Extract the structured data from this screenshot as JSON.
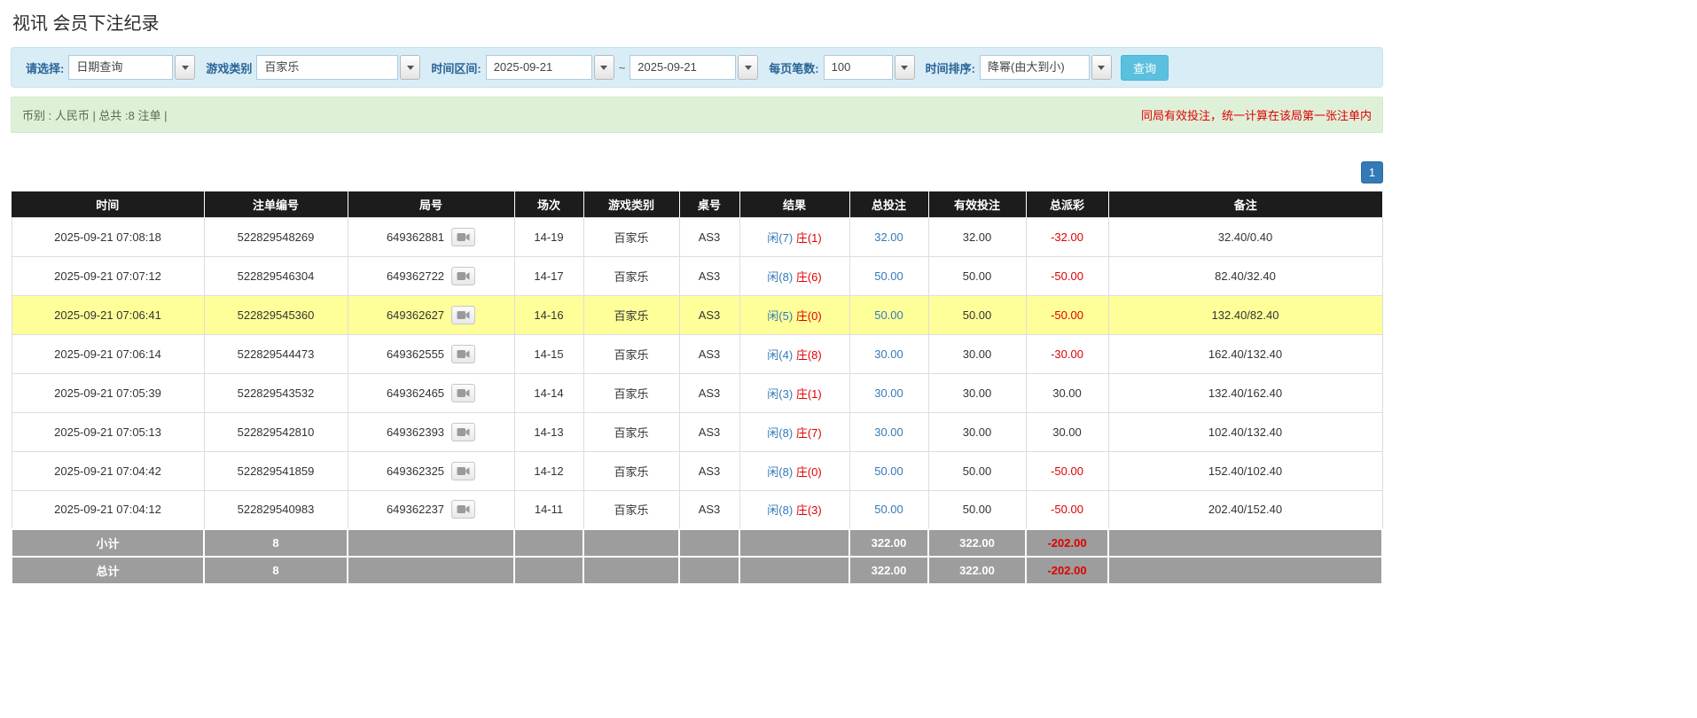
{
  "colors": {
    "accent_blue": "#337ab7",
    "button_blue": "#5bc0de",
    "label_blue": "#2a6496",
    "filter_bg": "#d9edf7",
    "info_bg": "#dff0d8",
    "header_bg": "#1c1c1c",
    "highlight_yellow": "#ffff99",
    "red": "#e00000",
    "footer_gray": "#9d9d9d"
  },
  "page": {
    "title": "视讯 会员下注纪录"
  },
  "filters": {
    "select_label": "请选择:",
    "select_value": "日期查询",
    "game_type_label": "游戏类别",
    "game_type_value": "百家乐",
    "time_range_label": "时间区间:",
    "date_from": "2025-09-21",
    "range_separator": "~",
    "date_to": "2025-09-21",
    "per_page_label": "每页笔数:",
    "per_page_value": "100",
    "sort_label": "时间排序:",
    "sort_value": "降幂(由大到小)",
    "search_button": "查询"
  },
  "info_bar": {
    "summary": "币别 : 人民币 | 总共 :8 注单 |",
    "notice": "同局有效投注，统一计算在该局第一张注单内"
  },
  "pagination": {
    "current_page": "1"
  },
  "table": {
    "headers": [
      "时间",
      "注单编号",
      "局号",
      "场次",
      "游戏类别",
      "桌号",
      "结果",
      "总投注",
      "有效投注",
      "总派彩",
      "备注"
    ],
    "rows": [
      {
        "time": "2025-09-21 07:08:18",
        "bet_id": "522829548269",
        "round_id": "649362881",
        "session": "14-19",
        "game_type": "百家乐",
        "table_id": "AS3",
        "result_player": "闲(7)",
        "result_banker": "庄(1)",
        "total_bet": "32.00",
        "valid_bet": "32.00",
        "payout": "-32.00",
        "remark": "32.40/0.40",
        "highlighted": false
      },
      {
        "time": "2025-09-21 07:07:12",
        "bet_id": "522829546304",
        "round_id": "649362722",
        "session": "14-17",
        "game_type": "百家乐",
        "table_id": "AS3",
        "result_player": "闲(8)",
        "result_banker": "庄(6)",
        "total_bet": "50.00",
        "valid_bet": "50.00",
        "payout": "-50.00",
        "remark": "82.40/32.40",
        "highlighted": false
      },
      {
        "time": "2025-09-21 07:06:41",
        "bet_id": "522829545360",
        "round_id": "649362627",
        "session": "14-16",
        "game_type": "百家乐",
        "table_id": "AS3",
        "result_player": "闲(5)",
        "result_banker": "庄(0)",
        "total_bet": "50.00",
        "valid_bet": "50.00",
        "payout": "-50.00",
        "remark": "132.40/82.40",
        "highlighted": true
      },
      {
        "time": "2025-09-21 07:06:14",
        "bet_id": "522829544473",
        "round_id": "649362555",
        "session": "14-15",
        "game_type": "百家乐",
        "table_id": "AS3",
        "result_player": "闲(4)",
        "result_banker": "庄(8)",
        "total_bet": "30.00",
        "valid_bet": "30.00",
        "payout": "-30.00",
        "remark": "162.40/132.40",
        "highlighted": false
      },
      {
        "time": "2025-09-21 07:05:39",
        "bet_id": "522829543532",
        "round_id": "649362465",
        "session": "14-14",
        "game_type": "百家乐",
        "table_id": "AS3",
        "result_player": "闲(3)",
        "result_banker": "庄(1)",
        "total_bet": "30.00",
        "valid_bet": "30.00",
        "payout": "30.00",
        "remark": "132.40/162.40",
        "highlighted": false
      },
      {
        "time": "2025-09-21 07:05:13",
        "bet_id": "522829542810",
        "round_id": "649362393",
        "session": "14-13",
        "game_type": "百家乐",
        "table_id": "AS3",
        "result_player": "闲(8)",
        "result_banker": "庄(7)",
        "total_bet": "30.00",
        "valid_bet": "30.00",
        "payout": "30.00",
        "remark": "102.40/132.40",
        "highlighted": false
      },
      {
        "time": "2025-09-21 07:04:42",
        "bet_id": "522829541859",
        "round_id": "649362325",
        "session": "14-12",
        "game_type": "百家乐",
        "table_id": "AS3",
        "result_player": "闲(8)",
        "result_banker": "庄(0)",
        "total_bet": "50.00",
        "valid_bet": "50.00",
        "payout": "-50.00",
        "remark": "152.40/102.40",
        "highlighted": false
      },
      {
        "time": "2025-09-21 07:04:12",
        "bet_id": "522829540983",
        "round_id": "649362237",
        "session": "14-11",
        "game_type": "百家乐",
        "table_id": "AS3",
        "result_player": "闲(8)",
        "result_banker": "庄(3)",
        "total_bet": "50.00",
        "valid_bet": "50.00",
        "payout": "-50.00",
        "remark": "202.40/152.40",
        "highlighted": false
      }
    ],
    "subtotal": {
      "label": "小计",
      "count": "8",
      "total_bet": "322.00",
      "valid_bet": "322.00",
      "payout": "-202.00"
    },
    "total": {
      "label": "总计",
      "count": "8",
      "total_bet": "322.00",
      "valid_bet": "322.00",
      "payout": "-202.00"
    }
  }
}
